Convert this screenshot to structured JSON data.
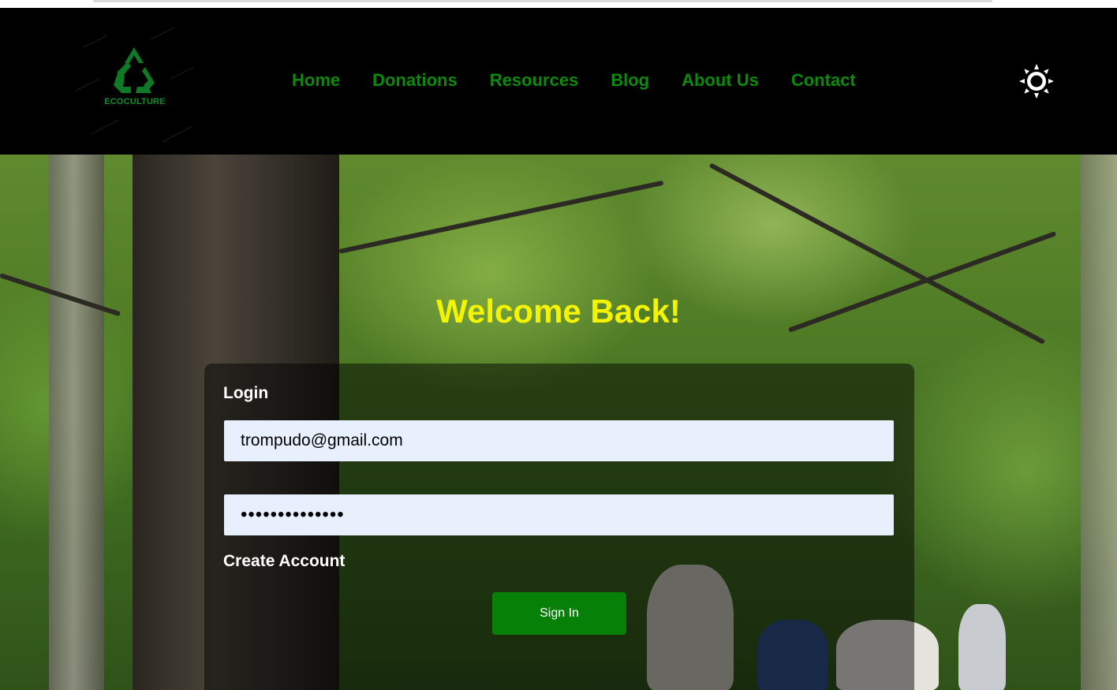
{
  "brand": {
    "name": "ECOCULTURE",
    "accent": "#0f8f2a"
  },
  "nav": {
    "items": [
      {
        "label": "Home"
      },
      {
        "label": "Donations"
      },
      {
        "label": "Resources"
      },
      {
        "label": "Blog"
      },
      {
        "label": "About Us"
      },
      {
        "label": "Contact"
      }
    ],
    "color": "#0b8a0b"
  },
  "theme_toggle": {
    "icon": "sun-icon"
  },
  "hero": {
    "heading": "Welcome Back!",
    "heading_color": "#f4f400"
  },
  "login": {
    "title": "Login",
    "email_value": "trompudo@gmail.com",
    "password_value": "••••••••••••••",
    "create_account_label": "Create Account",
    "submit_label": "Sign In",
    "submit_color": "#068006"
  }
}
